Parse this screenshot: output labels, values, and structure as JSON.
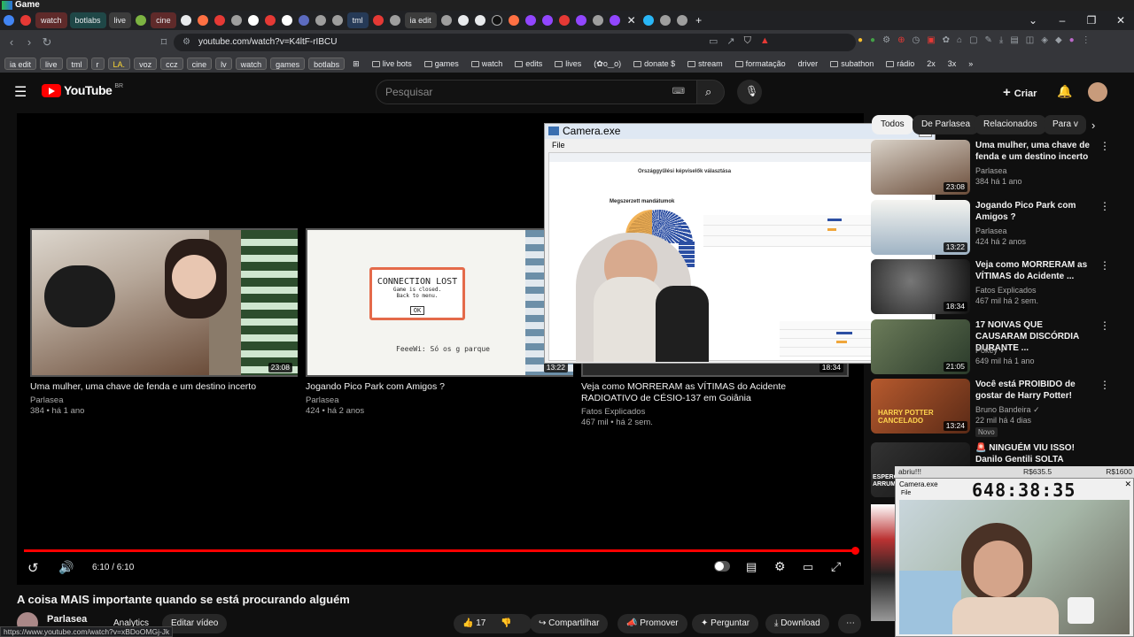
{
  "window": {
    "title": "Game"
  },
  "tabs": [
    {
      "label": "watch",
      "style": "red"
    },
    {
      "label": "botlabs",
      "style": "teal"
    },
    {
      "label": "live",
      "style": "grey"
    },
    {
      "label": "cine",
      "style": "red"
    },
    {
      "label": "tml",
      "style": "blue"
    },
    {
      "label": "ia edit",
      "style": "grey"
    }
  ],
  "address": {
    "url": "youtube.com/watch?v=K4ltF-rIBCU"
  },
  "bookmarks": [
    {
      "label": "ia edit",
      "boxed": true
    },
    {
      "label": "live",
      "boxed": true
    },
    {
      "label": "tml",
      "boxed": true
    },
    {
      "label": "r",
      "boxed": true
    },
    {
      "label": "LA.",
      "boxed": true
    },
    {
      "label": "voz",
      "boxed": true
    },
    {
      "label": "ccz",
      "boxed": true
    },
    {
      "label": "cine",
      "boxed": true
    },
    {
      "label": "lv",
      "boxed": true
    },
    {
      "label": "watch",
      "boxed": true
    },
    {
      "label": "games",
      "boxed": true
    },
    {
      "label": "botlabs",
      "boxed": true
    },
    {
      "label": "live bots",
      "boxed": false
    },
    {
      "label": "games",
      "boxed": false
    },
    {
      "label": "watch",
      "boxed": false
    },
    {
      "label": "edits",
      "boxed": false
    },
    {
      "label": "lives",
      "boxed": false
    },
    {
      "label": "(✿o‿o)",
      "boxed": false
    },
    {
      "label": "donate $",
      "boxed": false
    },
    {
      "label": "stream",
      "boxed": false
    },
    {
      "label": "formatação",
      "boxed": false
    },
    {
      "label": "driver",
      "boxed": false
    },
    {
      "label": "subathon",
      "boxed": false
    },
    {
      "label": "rádio",
      "boxed": false
    },
    {
      "label": "2x",
      "boxed": false
    },
    {
      "label": "3x",
      "boxed": false
    }
  ],
  "header": {
    "logo": "YouTube",
    "region": "BR",
    "search_placeholder": "Pesquisar",
    "create_label": "Criar"
  },
  "endscreen": [
    {
      "title": "Uma mulher, uma chave de fenda e um destino incerto",
      "channel": "Parlasea",
      "stats": "384 • há 1 ano",
      "duration": "23:08"
    },
    {
      "title": "Jogando Pico Park com Amigos ?",
      "channel": "Parlasea",
      "stats": "424 • há 2 anos",
      "duration": "13:22"
    },
    {
      "title": "Veja como MORRERAM as VÍTIMAS do Acidente RADIOATIVO de CÉSIO-137 em Goiânia",
      "channel": "Fatos Explicados",
      "stats": "467 mil • há 2 sem.",
      "duration": "18:34"
    }
  ],
  "thumb2": {
    "connection_title": "CONNECTION LOST",
    "connection_line1": "Game is closed.",
    "connection_line2": "Back to menu.",
    "ok": "OK",
    "chat_bottom": "FeeeWi: Só os g   parque"
  },
  "camera_window": {
    "title": "Camera.exe",
    "menu": "File",
    "close": "✕"
  },
  "player": {
    "time": "6:10 / 6:10",
    "progress": 1.0
  },
  "chips": [
    "Todos",
    "De Parlasea",
    "Relacionados",
    "Para v"
  ],
  "recommendations": [
    {
      "title": "Uma mulher, uma chave de fenda e um destino incerto",
      "channel": "Parlasea",
      "stats": "384  há 1 ano",
      "duration": "23:08",
      "badge": ""
    },
    {
      "title": "Jogando Pico Park com Amigos ?",
      "channel": "Parlasea",
      "stats": "424  há 2 anos",
      "duration": "13:22",
      "badge": ""
    },
    {
      "title": "Veja como MORRERAM as VÍTIMAS do Acidente ...",
      "channel": "Fatos Explicados",
      "stats": "467 mil  há 2 sem.",
      "duration": "18:34",
      "badge": ""
    },
    {
      "title": "17 NOIVAS QUE CAUSARAM DISCÓRDIA DURANTE ...",
      "channel": "Pokey",
      "stats": "649 mil  há 1 ano",
      "duration": "21:05",
      "badge": ""
    },
    {
      "title": "Você está PROIBIDO de gostar de Harry Potter!",
      "channel": "Bruno Bandeira",
      "stats": "22 mil  há 4 dias",
      "duration": "13:24",
      "badge": "Novo"
    },
    {
      "title": "NINGUÉM VIU ISSO! Danilo Gentili SOLTA DETALHE ...",
      "channel": "",
      "stats": "",
      "duration": "",
      "badge": ""
    }
  ],
  "thumb_text": {
    "harry": "HARRY POTTER CANCELADO",
    "espero": "ESPERO ARRUM"
  },
  "video": {
    "title": "A coisa MAIS importante quando se está procurando alguém",
    "channel": "Parlasea",
    "analytics": "Analytics",
    "edit": "Editar vídeo",
    "likes": "17",
    "share": "Compartilhar",
    "promote": "Promover",
    "ask": "Perguntar",
    "download": "Download"
  },
  "status_url": "https://www.youtube.com/watch?v=xBDoOMGj-Jk",
  "overlay": {
    "label": "abriu!!!",
    "money1": "R$635.5",
    "money2": "R$1600",
    "timer": "648:38:35",
    "cam_title": "Camera.exe",
    "cam_menu": "File"
  },
  "inner_page": {
    "heading": "Megszerzett mandátumok",
    "subheading": "Országgyűlési képviselők választása"
  },
  "colors": {
    "yt_red": "#ff0000",
    "bg": "#0f0f0f",
    "chip_bg": "#272727"
  }
}
